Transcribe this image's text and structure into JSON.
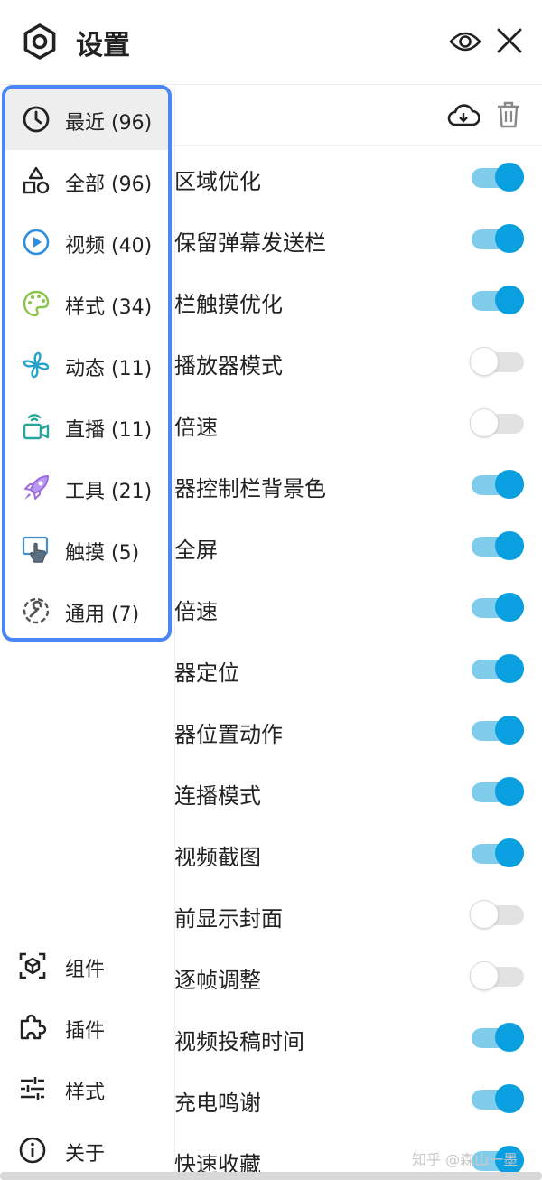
{
  "header": {
    "title": "设置",
    "logo_icon": "gear-hexagon-icon",
    "visibility_icon": "eye-icon",
    "close_icon": "close-icon"
  },
  "categories": [
    {
      "label": "最近 (96)",
      "icon": "clock-icon",
      "color": "#222222",
      "selected": true
    },
    {
      "label": "全部 (96)",
      "icon": "shapes-icon",
      "color": "#222222"
    },
    {
      "label": "视频 (40)",
      "icon": "play-circle-icon",
      "color": "#2f8ee0"
    },
    {
      "label": "样式 (34)",
      "icon": "palette-icon",
      "color": "#8bc34a"
    },
    {
      "label": "动态 (11)",
      "icon": "fan-icon",
      "color": "#26a1c9"
    },
    {
      "label": "直播 (11)",
      "icon": "live-camera-icon",
      "color": "#26a69a"
    },
    {
      "label": "工具 (21)",
      "icon": "rocket-icon",
      "color": "#9c6ce0"
    },
    {
      "label": "触摸 (5)",
      "icon": "touch-icon",
      "color": "#4a90c8"
    },
    {
      "label": "通用 (7)",
      "icon": "wrench-circle-icon",
      "color": "#555555"
    }
  ],
  "bottom_nav": [
    {
      "label": "组件",
      "icon": "cube-icon"
    },
    {
      "label": "插件",
      "icon": "puzzle-icon"
    },
    {
      "label": "样式",
      "icon": "sliders-icon"
    },
    {
      "label": "关于",
      "icon": "info-icon"
    }
  ],
  "toolbar": {
    "download_icon": "cloud-download-icon",
    "trash_icon": "trash-icon"
  },
  "settings": [
    {
      "label": "区域优化",
      "on": true
    },
    {
      "label": "保留弹幕发送栏",
      "on": true
    },
    {
      "label": "栏触摸优化",
      "on": true
    },
    {
      "label": "播放器模式",
      "on": false
    },
    {
      "label": "倍速",
      "on": false
    },
    {
      "label": "器控制栏背景色",
      "on": true
    },
    {
      "label": "全屏",
      "on": true
    },
    {
      "label": "倍速",
      "on": true
    },
    {
      "label": "器定位",
      "on": true
    },
    {
      "label": "器位置动作",
      "on": true
    },
    {
      "label": "连播模式",
      "on": true
    },
    {
      "label": "视频截图",
      "on": true
    },
    {
      "label": "前显示封面",
      "on": false
    },
    {
      "label": "逐帧调整",
      "on": false
    },
    {
      "label": "视频投稿时间",
      "on": true
    },
    {
      "label": "充电鸣谢",
      "on": true
    },
    {
      "label": "快速收藏",
      "on": true
    }
  ],
  "watermark": "知乎 @森山一墨",
  "colors": {
    "accent": "#0a9fe0",
    "track_on": "#7fcdeb",
    "panel_border": "#4a86f7"
  }
}
